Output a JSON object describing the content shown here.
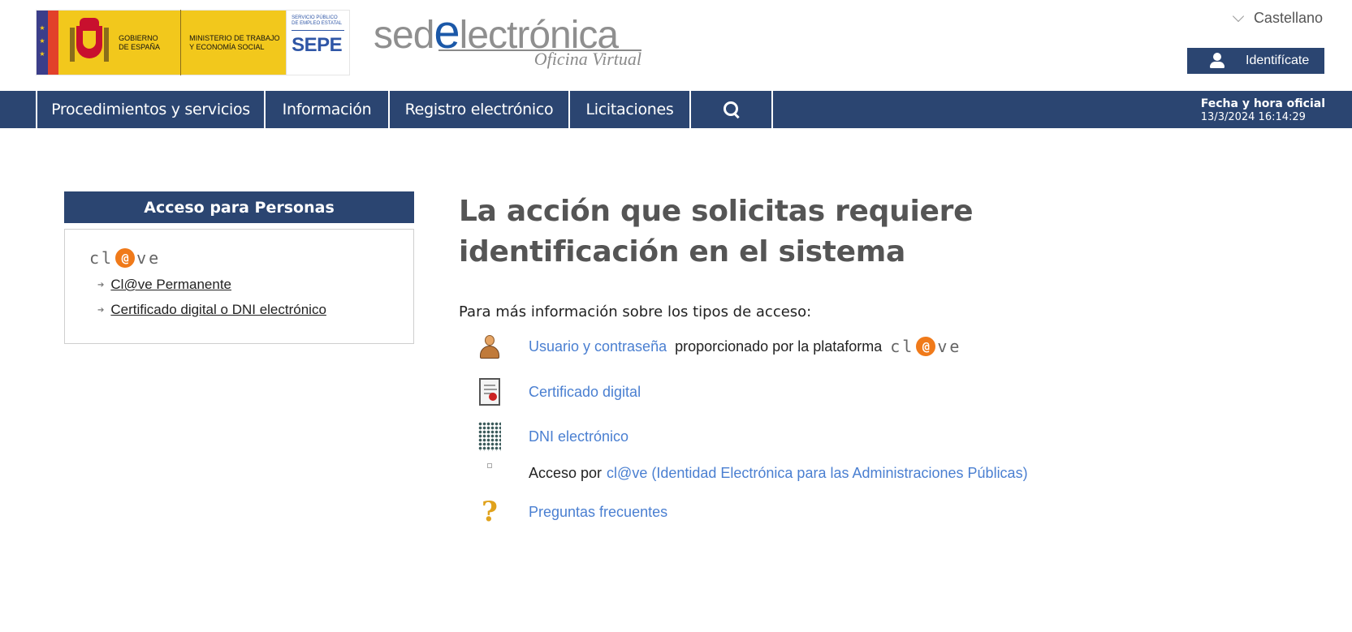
{
  "header": {
    "eu_stars": "★ ★ ★",
    "gobierno": "GOBIERNO DE ESPAÑA",
    "ministerio": "MINISTERIO DE TRABAJO Y ECONOMÍA SOCIAL",
    "sepe_small": "SERVICIO PÚBLICO DE EMPLEO ESTATAL",
    "sepe_big": "SEPE",
    "sede_prefix": "sed",
    "sede_e": "e",
    "sede_suffix": "lectrónica",
    "sede_subtitle": "Oficina Virtual",
    "language": "Castellano",
    "login_label": "Identifícate"
  },
  "nav": {
    "items": [
      {
        "label": "Procedimientos y servicios"
      },
      {
        "label": "Información"
      },
      {
        "label": "Registro electrónico"
      },
      {
        "label": "Licitaciones"
      }
    ],
    "search_icon": "search-icon",
    "clock_title": "Fecha y hora oficial",
    "clock_value": "13/3/2024 16:14:29"
  },
  "panel": {
    "title": "Acceso para Personas",
    "clave_logo": {
      "c": "cl",
      "at": "@",
      "ve": "ve"
    },
    "links": [
      {
        "label": "Cl@ve Permanente"
      },
      {
        "label": "Certificado digital o DNI electrónico"
      }
    ]
  },
  "main": {
    "title": "La acción que solicitas requiere identificación en el sistema",
    "intro": "Para más información sobre los tipos de acceso:",
    "options": [
      {
        "icon": "user-icon",
        "link": "Usuario y contraseña",
        "text": "proporcionado por la plataforma"
      },
      {
        "icon": "certificate-icon",
        "link": "Certificado digital"
      },
      {
        "icon": "dni-chip-icon",
        "link": "DNI electrónico"
      },
      {
        "icon": "small-image-icon",
        "prefix": "Acceso por",
        "link": "cl@ve (Identidad Electrónica para las Administraciones Públicas)"
      },
      {
        "icon": "question-icon",
        "link": "Preguntas frecuentes"
      }
    ]
  },
  "colors": {
    "nav_bg": "#2b4571",
    "link": "#4a7fd1",
    "clave_orange": "#f07a1a",
    "title_gray": "#555555"
  }
}
